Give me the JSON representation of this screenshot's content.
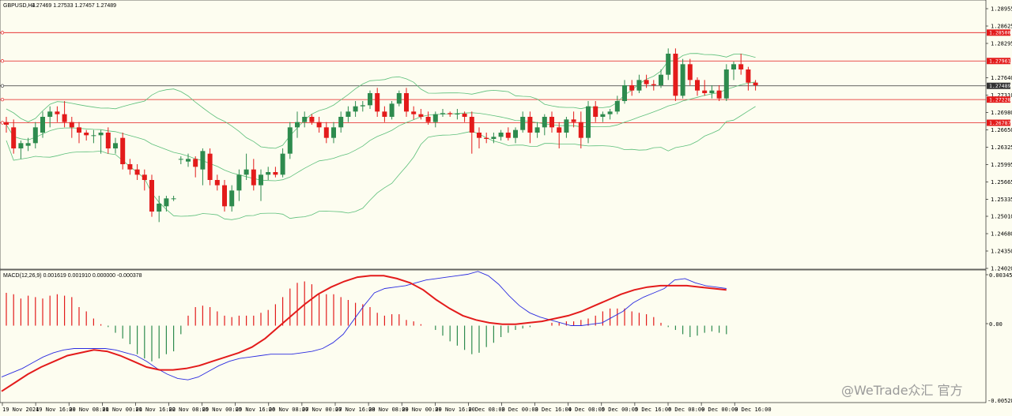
{
  "header": {
    "symbol": "GBPUSD,H4",
    "ohlc": "1.27469 1.27533 1.27457 1.27489"
  },
  "macd": {
    "label": "MACD(12,26,9) 0.001619 0.001910 0.000000 -0.000378",
    "ticks": [
      "0.003459",
      "0.00",
      "-0.00528"
    ]
  },
  "watermark": "@WeTrade众汇 官方",
  "colors": {
    "background": "#fdfdf0",
    "bull": "#2e8b4e",
    "bear": "#e31b1b",
    "band": "#5cbf7a",
    "level": "#e31b1b",
    "price_line": "#333333",
    "macd_line": "#2b2be0",
    "signal_line": "#e31b1b"
  },
  "chart_data": [
    {
      "type": "candlestick",
      "title": "GBPUSD,H4",
      "ylim": [
        1.2402,
        1.2906
      ],
      "price_ticks": [
        "1.28955",
        "1.28625",
        "1.28295",
        "1.27640",
        "1.27310",
        "1.26980",
        "1.26650",
        "1.26325",
        "1.25995",
        "1.25665",
        "1.25335",
        "1.25010",
        "1.24680",
        "1.24350",
        "1.24020"
      ],
      "x_labels": [
        "19 Nov 2024",
        "19 Nov 16:00",
        "20 Nov 08:00",
        "21 Nov 00:00",
        "21 Nov 16:00",
        "22 Nov 08:00",
        "25 Nov 00:00",
        "25 Nov 16:00",
        "26 Nov 08:00",
        "27 Nov 00:00",
        "27 Nov 16:00",
        "28 Nov 08:00",
        "29 Nov 00:00",
        "29 Nov 16:00",
        "2 Dec 08:00",
        "3 Dec 00:00",
        "3 Dec 16:00",
        "4 Dec 08:00",
        "5 Dec 00:00",
        "5 Dec 16:00",
        "6 Dec 08:00",
        "9 Dec 00:00",
        "9 Dec 16:00"
      ],
      "levels": [
        {
          "value": "1.28500",
          "y": 1.285,
          "color": "#e31b1b"
        },
        {
          "value": "1.27961",
          "y": 1.27961,
          "color": "#e31b1b"
        },
        {
          "value": "1.27489",
          "y": 1.27489,
          "color": "#333333"
        },
        {
          "value": "1.27228",
          "y": 1.27228,
          "color": "#e31b1b"
        },
        {
          "value": "1.26787",
          "y": 1.26787,
          "color": "#e31b1b"
        }
      ],
      "candles": [
        [
          1.268,
          1.269,
          1.266,
          1.2675
        ],
        [
          1.267,
          1.2685,
          1.262,
          1.263
        ],
        [
          1.263,
          1.2645,
          1.261,
          1.264
        ],
        [
          1.2635,
          1.265,
          1.2625,
          1.264
        ],
        [
          1.264,
          1.268,
          1.263,
          1.267
        ],
        [
          1.266,
          1.27,
          1.265,
          1.269
        ],
        [
          1.269,
          1.271,
          1.267,
          1.27
        ],
        [
          1.27,
          1.271,
          1.268,
          1.2695
        ],
        [
          1.2695,
          1.272,
          1.267,
          1.268
        ],
        [
          1.268,
          1.269,
          1.265,
          1.267
        ],
        [
          1.267,
          1.268,
          1.264,
          1.266
        ],
        [
          1.266,
          1.2665,
          1.2645,
          1.2655
        ],
        [
          1.2655,
          1.2665,
          1.264,
          1.2655
        ],
        [
          1.2655,
          1.2665,
          1.262,
          1.266
        ],
        [
          1.266,
          1.267,
          1.262,
          1.263
        ],
        [
          1.263,
          1.265,
          1.262,
          1.264
        ],
        [
          1.265,
          1.266,
          1.259,
          1.26
        ],
        [
          1.26,
          1.261,
          1.258,
          1.259
        ],
        [
          1.259,
          1.26,
          1.257,
          1.258
        ],
        [
          1.258,
          1.259,
          1.255,
          1.257
        ],
        [
          1.257,
          1.258,
          1.25,
          1.251
        ],
        [
          1.251,
          1.254,
          1.249,
          1.2525
        ],
        [
          1.252,
          1.254,
          1.251,
          1.2535
        ],
        [
          1.2535,
          1.254,
          1.253,
          1.2535
        ],
        [
          1.261,
          1.2615,
          1.26,
          1.261
        ],
        [
          1.2605,
          1.262,
          1.2595,
          1.261
        ],
        [
          1.261,
          1.2615,
          1.2575,
          1.2595
        ],
        [
          1.259,
          1.263,
          1.256,
          1.2625
        ],
        [
          1.262,
          1.263,
          1.256,
          1.257
        ],
        [
          1.257,
          1.258,
          1.255,
          1.256
        ],
        [
          1.256,
          1.257,
          1.251,
          1.252
        ],
        [
          1.252,
          1.256,
          1.251,
          1.255
        ],
        [
          1.255,
          1.259,
          1.253,
          1.258
        ],
        [
          1.258,
          1.262,
          1.257,
          1.259
        ],
        [
          1.259,
          1.261,
          1.255,
          1.256
        ],
        [
          1.256,
          1.259,
          1.253,
          1.258
        ],
        [
          1.258,
          1.2595,
          1.257,
          1.2585
        ],
        [
          1.2585,
          1.2595,
          1.2575,
          1.258
        ],
        [
          1.258,
          1.263,
          1.2575,
          1.262
        ],
        [
          1.262,
          1.268,
          1.261,
          1.267
        ],
        [
          1.267,
          1.27,
          1.265,
          1.268
        ],
        [
          1.268,
          1.27,
          1.267,
          1.269
        ],
        [
          1.269,
          1.2695,
          1.2675,
          1.268
        ],
        [
          1.268,
          1.269,
          1.266,
          1.267
        ],
        [
          1.267,
          1.268,
          1.264,
          1.265
        ],
        [
          1.265,
          1.268,
          1.264,
          1.267
        ],
        [
          1.267,
          1.27,
          1.266,
          1.269
        ],
        [
          1.269,
          1.271,
          1.268,
          1.27
        ],
        [
          1.27,
          1.272,
          1.269,
          1.271
        ],
        [
          1.271,
          1.272,
          1.27,
          1.2712
        ],
        [
          1.2712,
          1.274,
          1.2705,
          1.2735
        ],
        [
          1.2735,
          1.2745,
          1.269,
          1.27
        ],
        [
          1.27,
          1.271,
          1.268,
          1.269
        ],
        [
          1.269,
          1.272,
          1.2685,
          1.2715
        ],
        [
          1.2715,
          1.274,
          1.271,
          1.2735
        ],
        [
          1.2735,
          1.2745,
          1.269,
          1.27
        ],
        [
          1.27,
          1.271,
          1.2685,
          1.2695
        ],
        [
          1.2695,
          1.2705,
          1.2685,
          1.269
        ],
        [
          1.269,
          1.27,
          1.2675,
          1.268
        ],
        [
          1.268,
          1.27,
          1.267,
          1.2695
        ],
        [
          1.2695,
          1.2705,
          1.269,
          1.2697
        ],
        [
          1.2697,
          1.27,
          1.269,
          1.2695
        ],
        [
          1.2695,
          1.2705,
          1.2685,
          1.2696
        ],
        [
          1.2696,
          1.27,
          1.268,
          1.269
        ],
        [
          1.269,
          1.27,
          1.262,
          1.266
        ],
        [
          1.266,
          1.267,
          1.263,
          1.265
        ],
        [
          1.265,
          1.266,
          1.264,
          1.2648
        ],
        [
          1.2648,
          1.266,
          1.264,
          1.2652
        ],
        [
          1.2652,
          1.2665,
          1.2645,
          1.266
        ],
        [
          1.266,
          1.267,
          1.2645,
          1.265
        ],
        [
          1.265,
          1.267,
          1.264,
          1.2665
        ],
        [
          1.2665,
          1.27,
          1.266,
          1.269
        ],
        [
          1.269,
          1.27,
          1.264,
          1.266
        ],
        [
          1.266,
          1.268,
          1.265,
          1.267
        ],
        [
          1.267,
          1.2695,
          1.2655,
          1.269
        ],
        [
          1.269,
          1.27,
          1.266,
          1.267
        ],
        [
          1.267,
          1.268,
          1.263,
          1.266
        ],
        [
          1.266,
          1.269,
          1.265,
          1.2685
        ],
        [
          1.2685,
          1.27,
          1.267,
          1.268
        ],
        [
          1.268,
          1.27,
          1.263,
          1.265
        ],
        [
          1.265,
          1.272,
          1.264,
          1.271
        ],
        [
          1.271,
          1.272,
          1.268,
          1.269
        ],
        [
          1.269,
          1.27,
          1.268,
          1.2695
        ],
        [
          1.2695,
          1.2705,
          1.2685,
          1.27
        ],
        [
          1.27,
          1.273,
          1.2695,
          1.272
        ],
        [
          1.272,
          1.276,
          1.2715,
          1.275
        ],
        [
          1.275,
          1.276,
          1.273,
          1.274
        ],
        [
          1.274,
          1.277,
          1.2735,
          1.276
        ],
        [
          1.276,
          1.277,
          1.2745,
          1.2752
        ],
        [
          1.2752,
          1.276,
          1.274,
          1.275
        ],
        [
          1.275,
          1.278,
          1.2745,
          1.277
        ],
        [
          1.277,
          1.282,
          1.276,
          1.281
        ],
        [
          1.281,
          1.282,
          1.272,
          1.273
        ],
        [
          1.273,
          1.28,
          1.2725,
          1.279
        ],
        [
          1.279,
          1.28,
          1.275,
          1.276
        ],
        [
          1.276,
          1.2765,
          1.273,
          1.274
        ],
        [
          1.274,
          1.276,
          1.273,
          1.2735
        ],
        [
          1.2735,
          1.275,
          1.2725,
          1.274
        ],
        [
          1.274,
          1.275,
          1.272,
          1.2725
        ],
        [
          1.2725,
          1.279,
          1.272,
          1.278
        ],
        [
          1.278,
          1.2795,
          1.276,
          1.279
        ],
        [
          1.279,
          1.281,
          1.277,
          1.278
        ],
        [
          1.278,
          1.2785,
          1.274,
          1.2755
        ],
        [
          1.2755,
          1.276,
          1.274,
          1.275
        ]
      ]
    },
    {
      "type": "line",
      "title": "MACD(12,26,9)",
      "ylim": [
        -0.00528,
        0.003459
      ],
      "histogram": [
        0.0023,
        0.0022,
        0.0019,
        0.0021,
        0.002,
        0.0019,
        0.0021,
        0.0022,
        0.0021,
        0.002,
        0.0013,
        0.001,
        0.0005,
        0.0001,
        -0.0001,
        -0.0005,
        -0.0009,
        -0.0013,
        -0.002,
        -0.0023,
        -0.0025,
        -0.0023,
        -0.002,
        -0.0018,
        -0.0006,
        0.0007,
        0.0013,
        0.0014,
        0.0013,
        0.001,
        0.0007,
        0.0006,
        0.0007,
        0.0007,
        0.0007,
        0.0009,
        0.0011,
        0.0015,
        0.002,
        0.0026,
        0.003,
        0.0031,
        0.0029,
        0.0023,
        0.0022,
        0.0022,
        0.002,
        0.0018,
        0.0016,
        0.0015,
        0.0013,
        0.0009,
        0.0007,
        0.0008,
        0.0008,
        0.0004,
        0.0003,
        0.0001,
        0.0,
        -0.0003,
        -0.0007,
        -0.0011,
        -0.0014,
        -0.0017,
        -0.002,
        -0.0019,
        -0.0015,
        -0.0012,
        -0.0008,
        -0.0005,
        -0.0003,
        -0.0002,
        -0.0001,
        0.0,
        0.0,
        0.0002,
        0.0002,
        0.0003,
        0.0003,
        0.0004,
        0.0005,
        0.0007,
        0.001,
        0.0012,
        0.0012,
        0.0012,
        0.001,
        0.0009,
        0.0008,
        0.0006,
        0.0002,
        -0.0001,
        -0.0003,
        -0.0006,
        -0.0008,
        -0.0007,
        -0.0005,
        -0.0004,
        -0.0005,
        -0.0006
      ],
      "macd": [
        -0.0036,
        -0.0033,
        -0.003,
        -0.0026,
        -0.0022,
        -0.0019,
        -0.0017,
        -0.0016,
        -0.0016,
        -0.0016,
        -0.0016,
        -0.0017,
        -0.0019,
        -0.0021,
        -0.0025,
        -0.003,
        -0.0034,
        -0.0037,
        -0.0038,
        -0.0036,
        -0.0032,
        -0.0028,
        -0.0025,
        -0.0023,
        -0.0022,
        -0.0021,
        -0.002,
        -0.002,
        -0.002,
        -0.0019,
        -0.0018,
        -0.0016,
        -0.0012,
        -0.0006,
        0.0004,
        0.0014,
        0.0023,
        0.0026,
        0.0027,
        0.0028,
        0.003,
        0.0032,
        0.0033,
        0.0034,
        0.0035,
        0.0036,
        0.0038,
        0.0035,
        0.0029,
        0.0021,
        0.0014,
        0.0009,
        0.0006,
        0.0004,
        0.0002,
        0.0,
        0.0,
        0.0001,
        0.0002,
        0.0006,
        0.001,
        0.0016,
        0.002,
        0.0023,
        0.0026,
        0.0032,
        0.0033,
        0.003,
        0.0028,
        0.0027,
        0.0026
      ],
      "signal": [
        -0.0046,
        -0.004,
        -0.0034,
        -0.0029,
        -0.0025,
        -0.0021,
        -0.0019,
        -0.0017,
        -0.0018,
        -0.0021,
        -0.0025,
        -0.0029,
        -0.0031,
        -0.0031,
        -0.003,
        -0.0028,
        -0.0025,
        -0.0022,
        -0.0019,
        -0.0015,
        -0.0009,
        -0.0001,
        0.0007,
        0.0015,
        0.0022,
        0.0027,
        0.0031,
        0.0034,
        0.0035,
        0.0035,
        0.0033,
        0.003,
        0.0025,
        0.0018,
        0.0012,
        0.0007,
        0.0004,
        0.0002,
        0.0001,
        0.0001,
        0.0002,
        0.0003,
        0.0005,
        0.0007,
        0.001,
        0.0014,
        0.0018,
        0.0022,
        0.0025,
        0.0027,
        0.0028,
        0.0028,
        0.0028,
        0.0027,
        0.0026,
        0.0025
      ]
    }
  ]
}
